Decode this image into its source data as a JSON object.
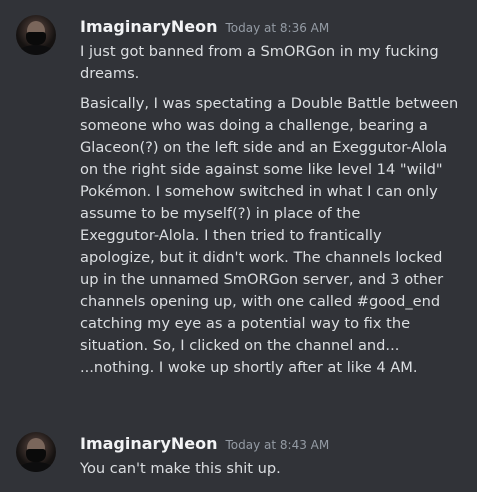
{
  "messages": [
    {
      "username": "ImaginaryNeon",
      "timestamp": "Today at 8:36 AM",
      "avatar_icon": "masked-person-avatar",
      "paragraphs": [
        [
          "I just got banned from a SmORGon in my fucking",
          "dreams."
        ],
        [
          "Basically, I was spectating a Double Battle between",
          "someone who was doing a challenge, bearing a",
          "Glaceon(?) on the left side and an Exeggutor-Alola",
          "on the right side against some like level 14 \"wild\"",
          "Pokémon. I somehow switched in what I can only",
          "assume to be myself(?) in place of the",
          "Exeggutor-Alola. I then tried to frantically",
          "apologize, but it didn't work. The channels locked",
          "up in the unnamed SmORGon server, and 3 other",
          "channels opening up, with one called #good_end",
          "catching my eye as a potential way to fix the",
          "situation. So, I clicked on the channel and...",
          "...nothing. I woke up shortly after at like 4 AM."
        ]
      ]
    },
    {
      "username": "ImaginaryNeon",
      "timestamp": "Today at 8:43 AM",
      "avatar_icon": "masked-person-avatar",
      "paragraphs": [
        [
          "You can't make this shit up."
        ]
      ]
    }
  ],
  "colors": {
    "background": "#313338",
    "username": "#f2f3f5",
    "timestamp": "#949ba4",
    "text": "#dbdee1"
  }
}
